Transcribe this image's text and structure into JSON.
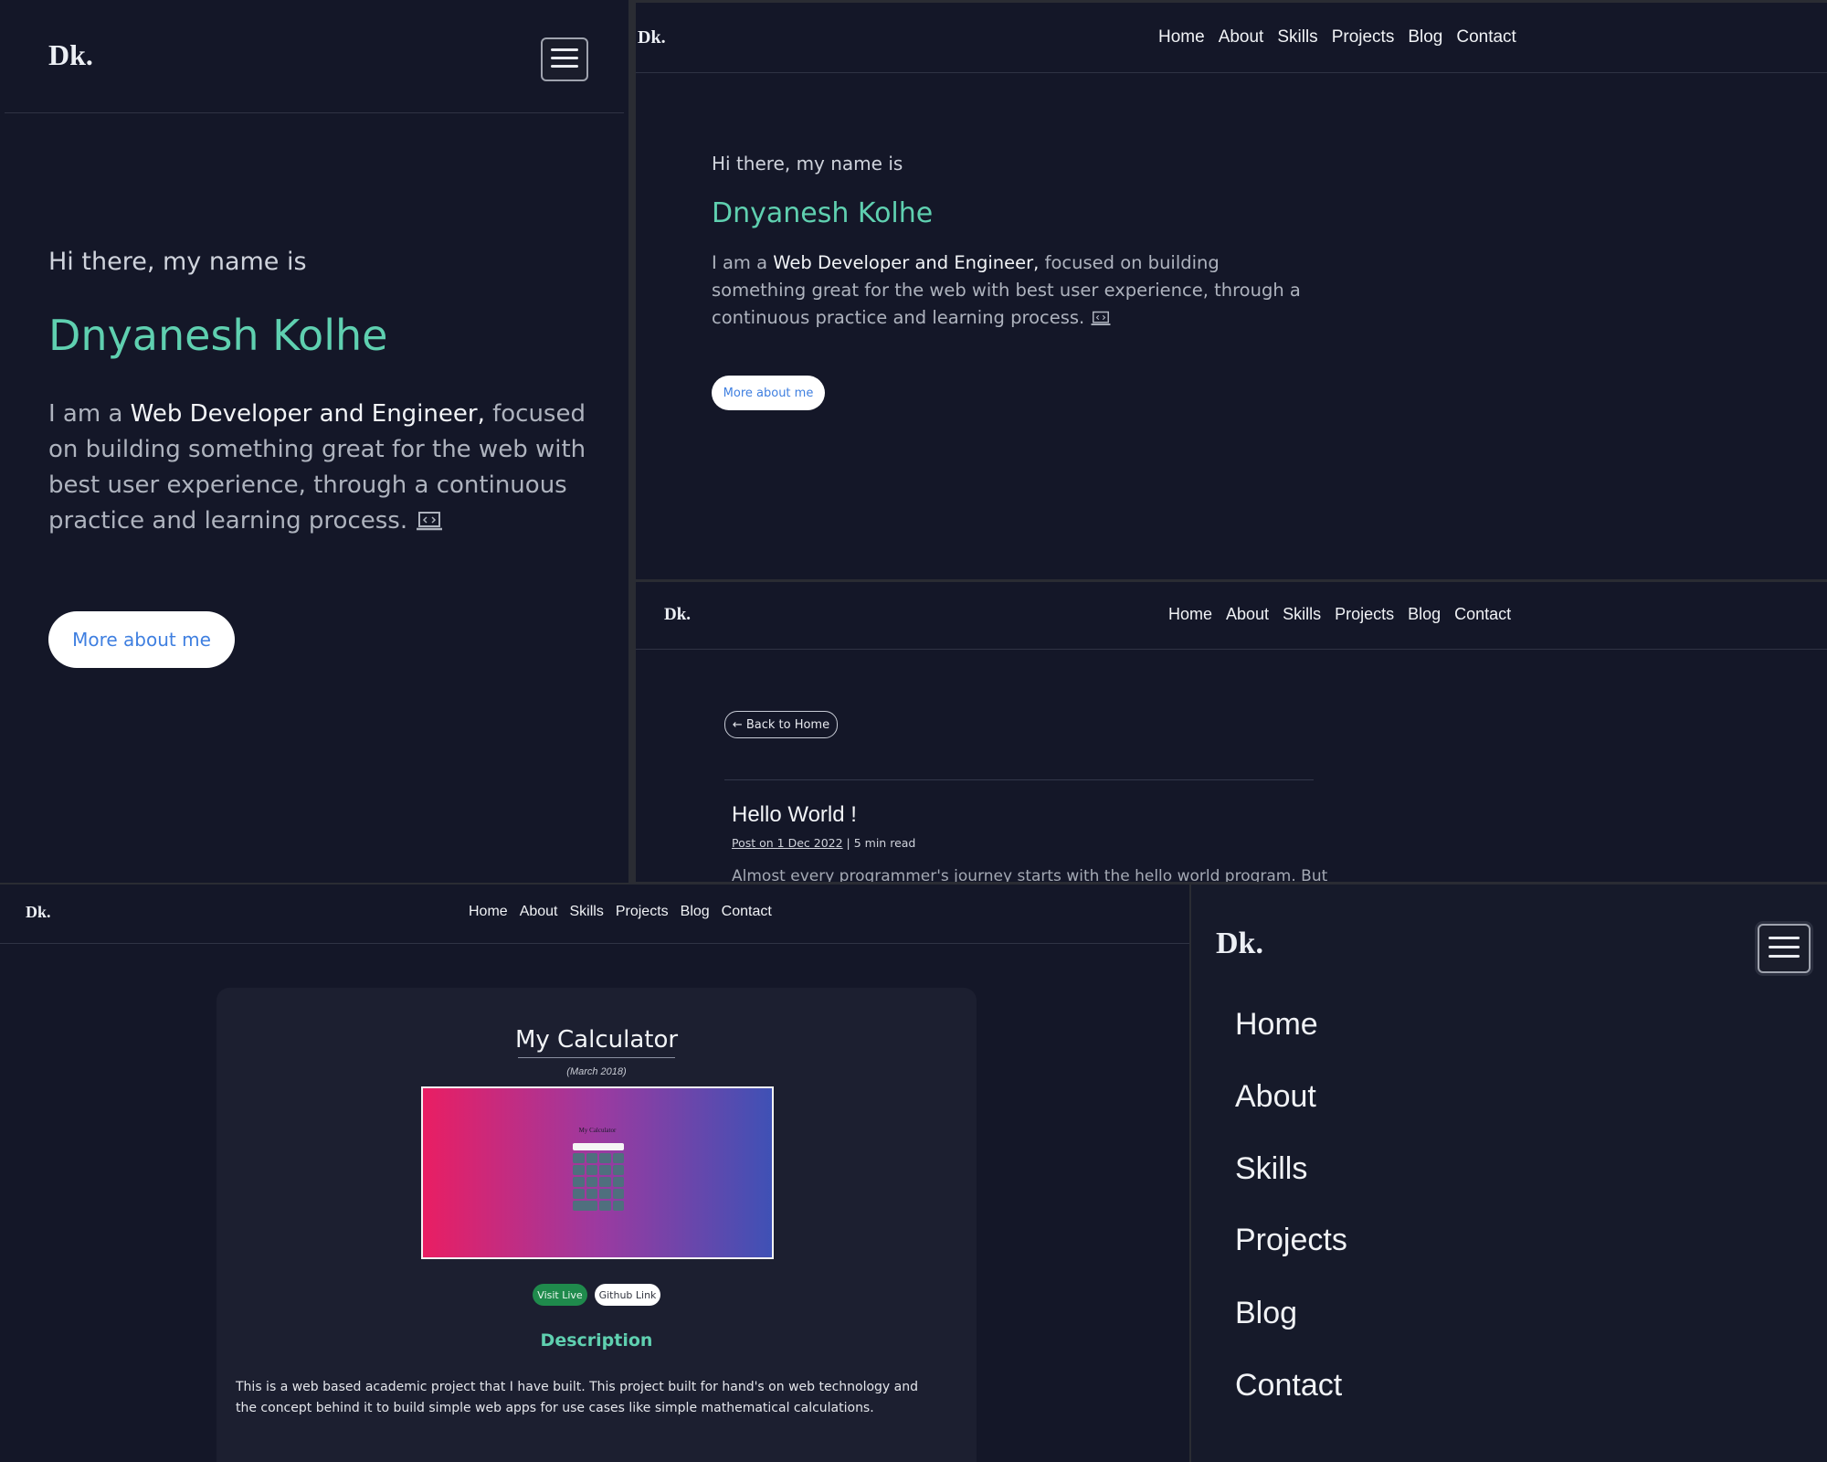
{
  "brand": "Dk.",
  "nav": [
    "Home",
    "About",
    "Skills",
    "Projects",
    "Blog",
    "Contact"
  ],
  "hero": {
    "greeting": "Hi there, my name is",
    "name": "Dnyanesh Kolhe",
    "bio_prefix": "I am a ",
    "bio_highlight": "Web Developer and Engineer,",
    "bio_rest": " focused on building something great for the web with best user experience, through a continuous practice and learning process.",
    "button": "More about me"
  },
  "blog": {
    "back_button": "Back to Home",
    "title": "Hello World !",
    "meta_date": "Post on 1 Dec 2022",
    "meta_read": " | 5 min read",
    "excerpt": "Almost every programmer's journey starts with the hello world program. But"
  },
  "project": {
    "title": "My Calculator",
    "date": "(March 2018)",
    "thumb_title": "My Calculator",
    "visit_button": "Visit Live",
    "github_button": "Github Link",
    "description_heading": "Description",
    "description": "This is a web based academic project that I have built. This project built for hand's on web technology and the concept behind it to build simple web apps for use cases like simple mathematical calculations."
  },
  "colors": {
    "background": "#141728",
    "accent": "#5fd0b0",
    "button_text": "#3f7fe0",
    "visit_green": "#1f8a4c"
  },
  "icons": [
    "menu-icon",
    "laptop-code-icon",
    "arrow-left-icon"
  ]
}
